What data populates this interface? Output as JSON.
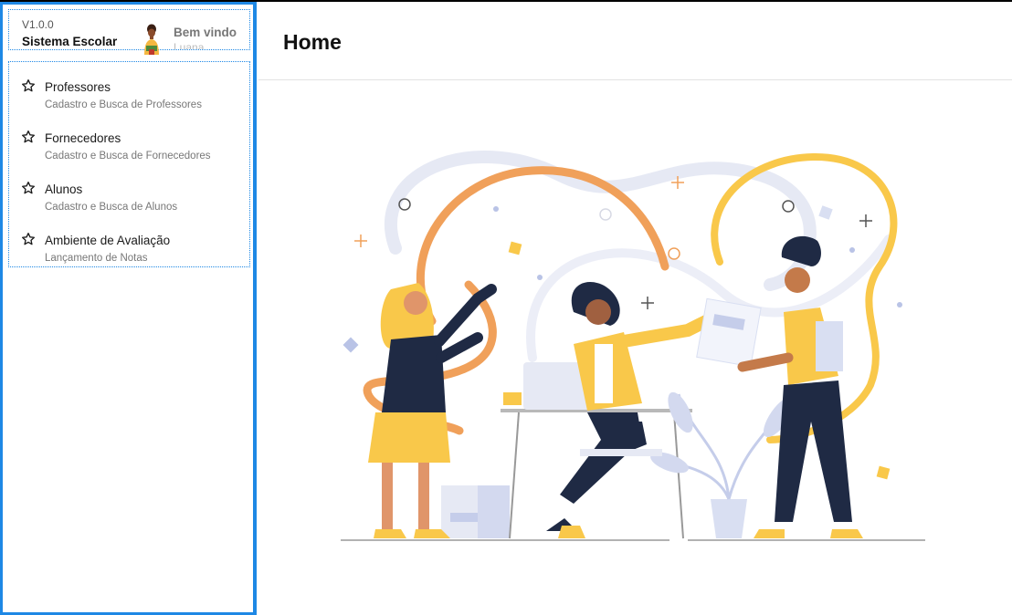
{
  "app": {
    "version": "V1.0.0",
    "name": "Sistema Escolar",
    "welcome": "Bem vindo",
    "user": "Luana"
  },
  "menu": {
    "items": [
      {
        "label": "Professores",
        "description": "Cadastro e Busca de Professores",
        "icon": "star-icon"
      },
      {
        "label": "Fornecedores",
        "description": "Cadastro e Busca de Fornecedores",
        "icon": "star-icon"
      },
      {
        "label": "Alunos",
        "description": "Cadastro e Busca de Alunos",
        "icon": "star-icon"
      },
      {
        "label": "Ambiente de Avaliação",
        "description": "Lançamento de Notas",
        "icon": "star-icon"
      }
    ]
  },
  "main": {
    "title": "Home"
  },
  "colors": {
    "accent": "#1e88e5",
    "illustration_yellow": "#f9c84a",
    "illustration_orange": "#f0a05a",
    "illustration_navy": "#1f2a44"
  }
}
